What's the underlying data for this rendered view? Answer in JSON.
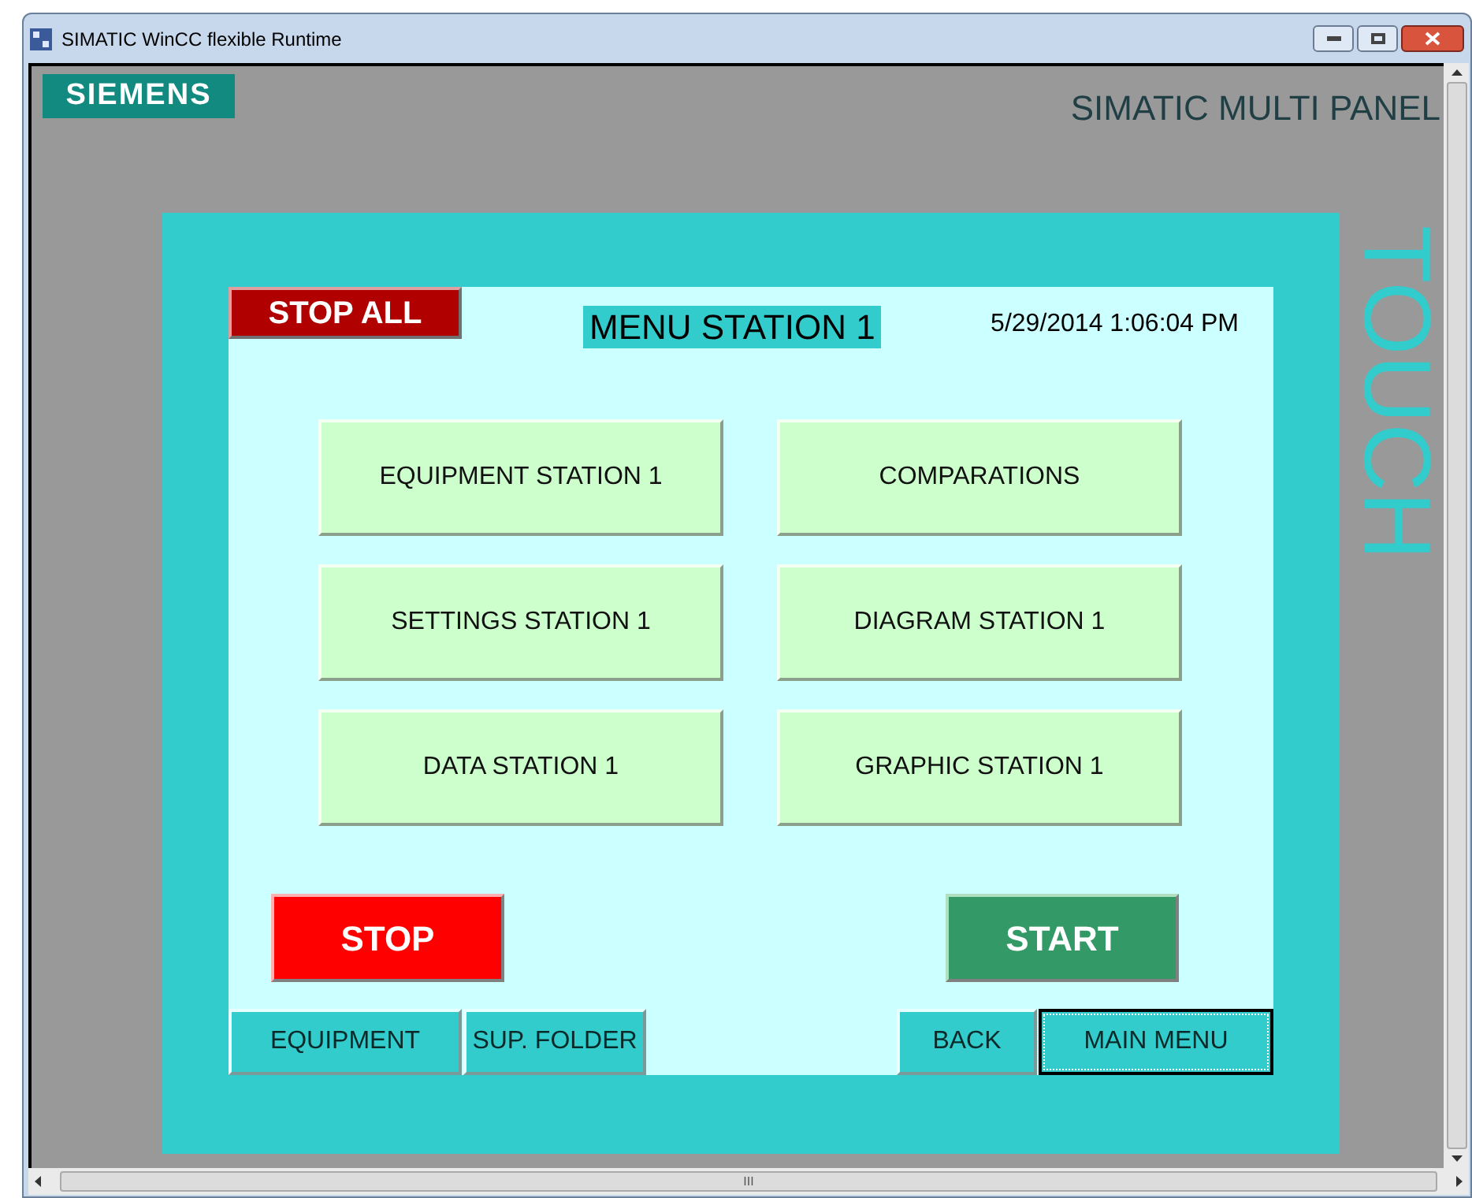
{
  "window": {
    "title": "SIMATIC WinCC flexible Runtime"
  },
  "brand": {
    "logo": "SIEMENS",
    "panel_name": "SIMATIC MULTI PANEL",
    "side_label": "TOUCH"
  },
  "screen": {
    "stop_all": "STOP ALL",
    "title": "MENU STATION 1",
    "datetime": "5/29/2014 1:06:04 PM",
    "menu_buttons": [
      "EQUIPMENT STATION 1",
      "COMPARATIONS",
      "SETTINGS STATION 1",
      "DIAGRAM STATION 1",
      "DATA STATION 1",
      "GRAPHIC STATION 1"
    ],
    "stop": "STOP",
    "start": "START",
    "nav_left": [
      {
        "label": "EQUIPMENT",
        "selected": false
      },
      {
        "label": "SUP. FOLDER",
        "selected": false
      }
    ],
    "nav_right": [
      {
        "label": "BACK",
        "selected": false
      },
      {
        "label": "MAIN MENU",
        "selected": true
      }
    ]
  },
  "scrollbar_grip": "III"
}
